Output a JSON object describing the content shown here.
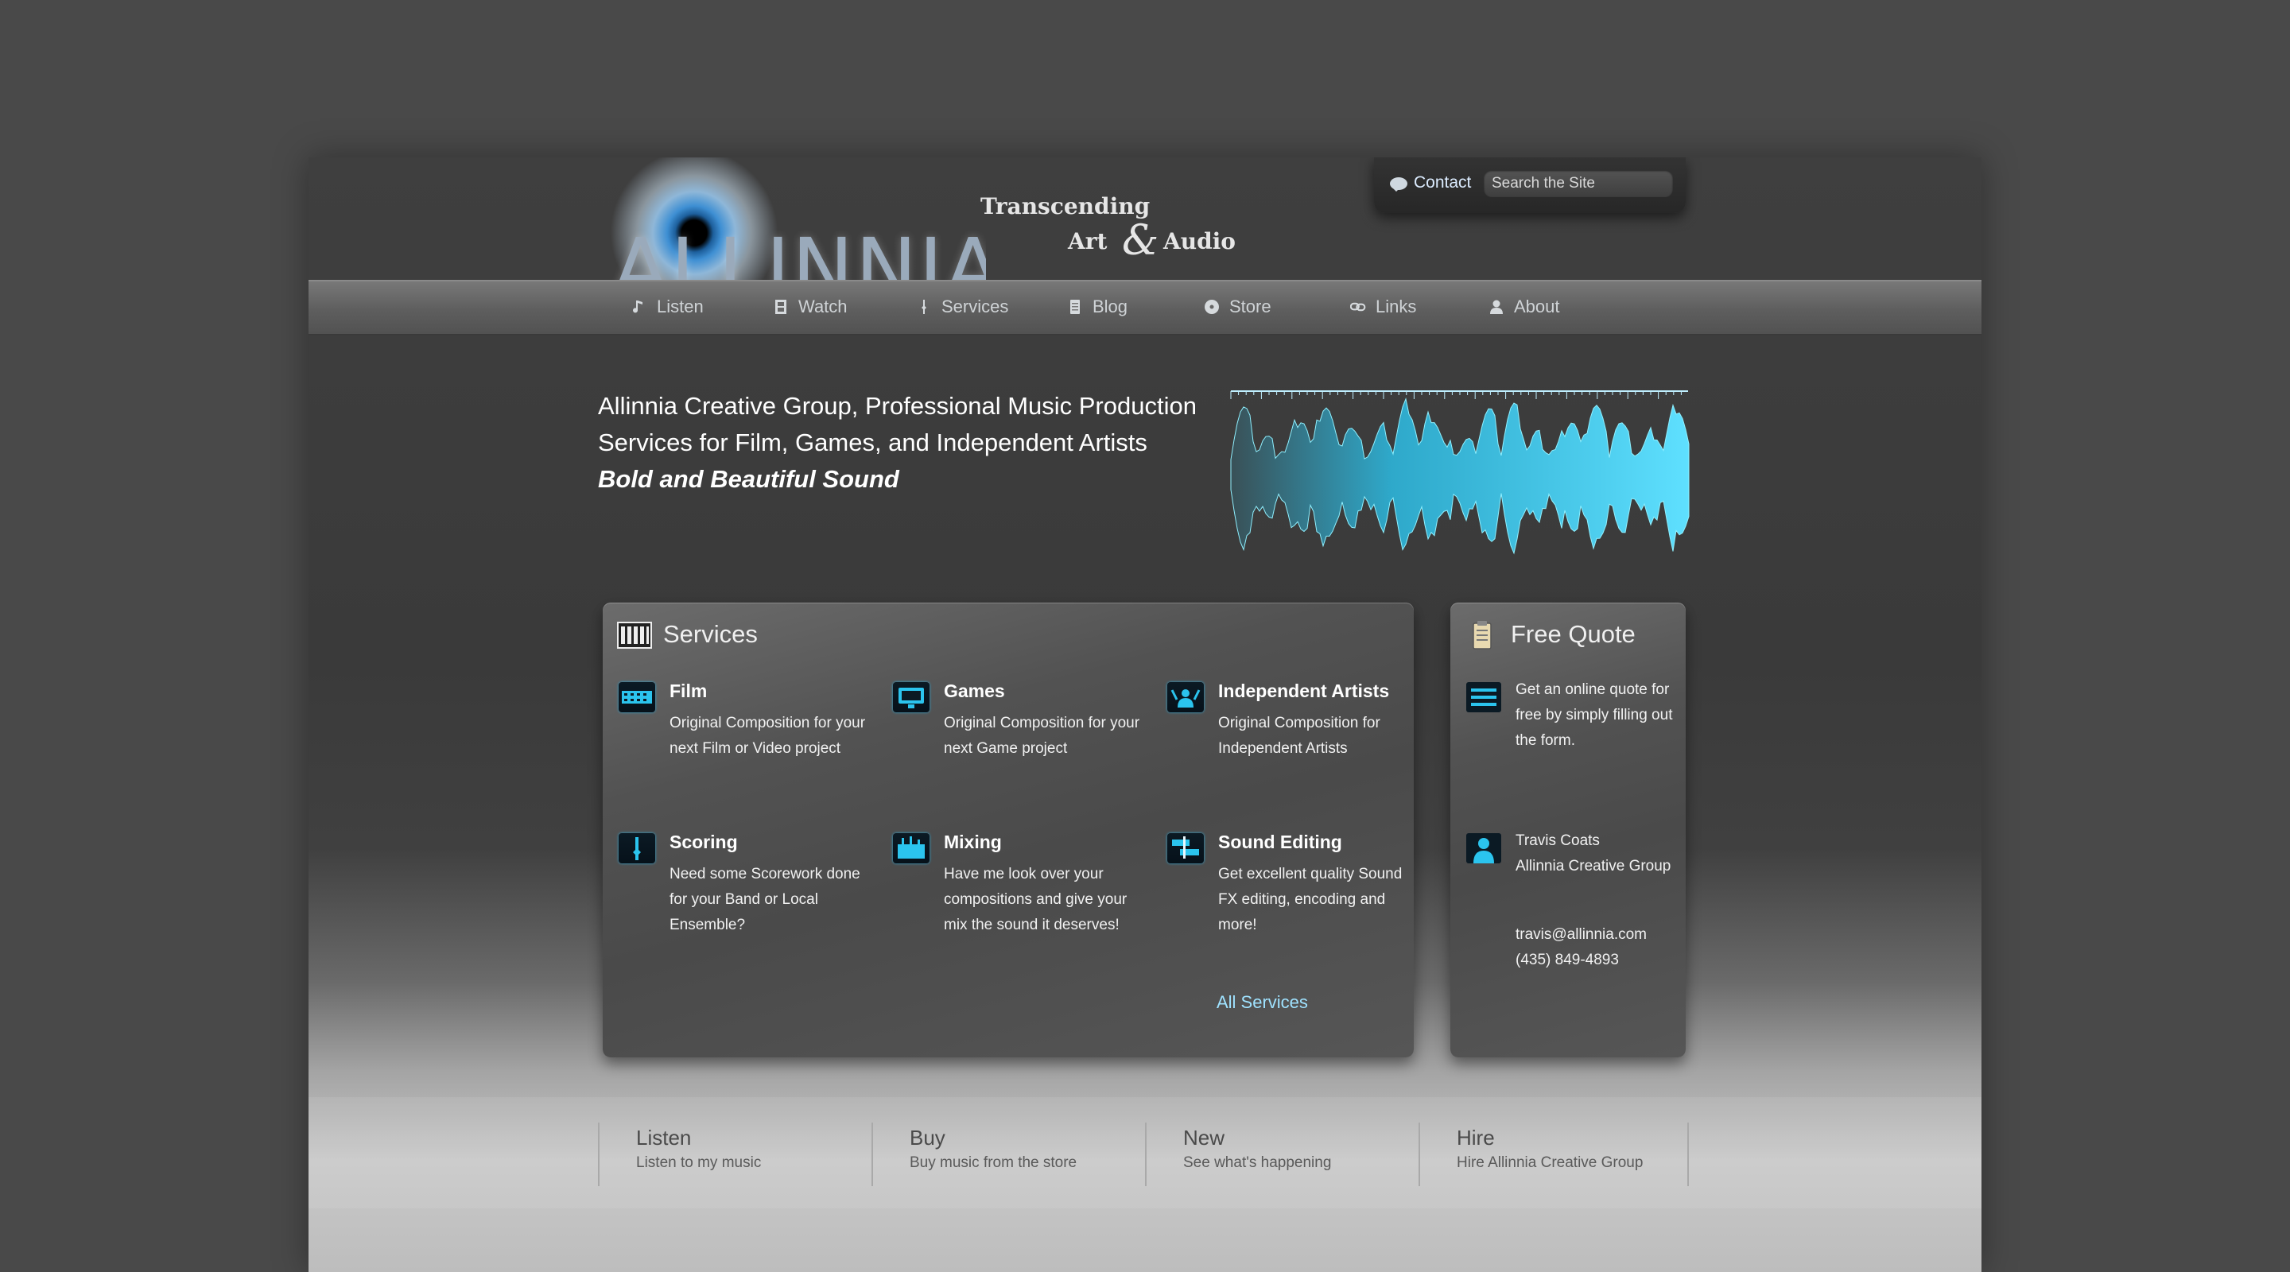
{
  "header": {
    "logo": "ALLINNIA",
    "tagline_line1": "Transcending",
    "tagline_art": "Art",
    "tagline_amp": "&",
    "tagline_audio": "Audio",
    "contact_label": "Contact",
    "search_placeholder": "Search the Site"
  },
  "nav": [
    {
      "label": "Listen",
      "icon": "music-note-icon"
    },
    {
      "label": "Watch",
      "icon": "film-icon"
    },
    {
      "label": "Services",
      "icon": "tuning-fork-icon"
    },
    {
      "label": "Blog",
      "icon": "document-icon"
    },
    {
      "label": "Store",
      "icon": "disc-icon"
    },
    {
      "label": "Links",
      "icon": "chain-link-icon"
    },
    {
      "label": "About",
      "icon": "person-icon"
    }
  ],
  "hero": {
    "line1": "Allinnia Creative Group, Professional Music Production",
    "line2": "Services for Film, Games, and Independent Artists",
    "subtitle": "Bold and Beautiful Sound"
  },
  "services": {
    "title": "Services",
    "items": [
      {
        "title": "Film",
        "desc": "Original Composition for your next Film or Video project"
      },
      {
        "title": "Games",
        "desc": "Original Composition for your next Game project"
      },
      {
        "title": "Independent Artists",
        "desc": "Original Composition for Independent Artists"
      },
      {
        "title": "Scoring",
        "desc": "Need some Scorework done for your Band or Local Ensemble?"
      },
      {
        "title": "Mixing",
        "desc": "Have me look over your compositions and give your mix the sound it deserves!"
      },
      {
        "title": "Sound Editing",
        "desc": "Get excellent quality Sound FX editing, encoding and more!"
      }
    ],
    "all_link": "All Services"
  },
  "quote": {
    "title": "Free Quote",
    "text": "Get an online quote for free by simply filling out the form.",
    "contact_name": "Travis Coats",
    "contact_org": "Allinnia Creative Group",
    "email": "travis@allinnia.com",
    "phone": "(435) 849-4893"
  },
  "footer": [
    {
      "title": "Listen",
      "sub": "Listen to my music"
    },
    {
      "title": "Buy",
      "sub": "Buy music from the store"
    },
    {
      "title": "New",
      "sub": "See what's happening"
    },
    {
      "title": "Hire",
      "sub": "Hire Allinnia Creative Group"
    }
  ],
  "colors": {
    "accent": "#2bc4ee",
    "link": "#9fe2ff",
    "background": "#494949"
  }
}
